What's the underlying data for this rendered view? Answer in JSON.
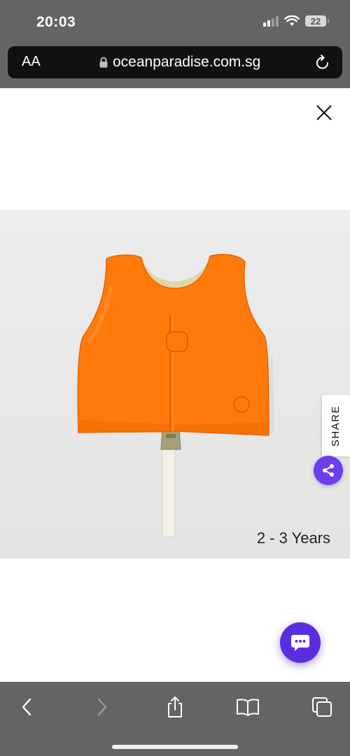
{
  "status_bar": {
    "time": "20:03",
    "battery": "22"
  },
  "browser": {
    "text_size_label": "AA",
    "url": "oceanparadise.com.sg"
  },
  "product": {
    "age_caption": "2 - 3 Years"
  },
  "share": {
    "label": "SHARE"
  },
  "colors": {
    "accent": "#6d3df0",
    "vest": "#ff7a00",
    "chrome": "#646464"
  }
}
